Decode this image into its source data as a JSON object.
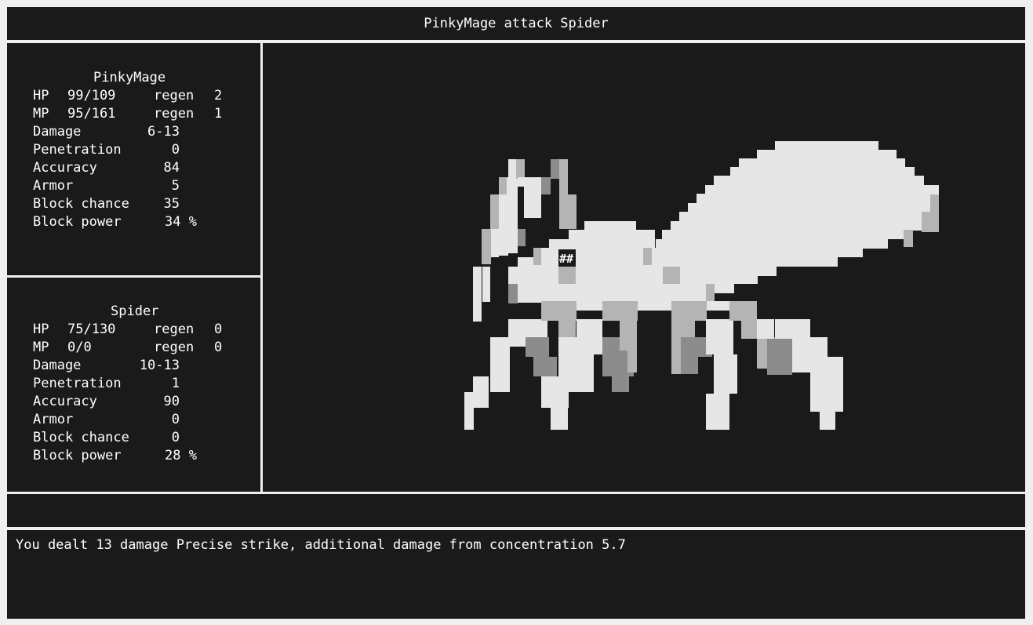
{
  "title": "PinkyMage attack Spider",
  "player": {
    "name": "PinkyMage",
    "stats": [
      {
        "label": "HP",
        "value": "99/109",
        "regen_label": "regen",
        "regen": "2"
      },
      {
        "label": "MP",
        "value": "95/161",
        "regen_label": "regen",
        "regen": "1"
      },
      {
        "label": "Damage",
        "value": "6-13"
      },
      {
        "label": "Penetration",
        "value": "0"
      },
      {
        "label": "Accuracy",
        "value": "84"
      },
      {
        "label": "Armor",
        "value": "5"
      },
      {
        "label": "Block chance",
        "value": "35"
      },
      {
        "label": "Block power",
        "value": "34 %"
      }
    ]
  },
  "enemy": {
    "name": "Spider",
    "stats": [
      {
        "label": "HP",
        "value": "75/130",
        "regen_label": "regen",
        "regen": "0"
      },
      {
        "label": "MP",
        "value": "0/0",
        "regen_label": "regen",
        "regen": "0"
      },
      {
        "label": "Damage",
        "value": "10-13"
      },
      {
        "label": "Penetration",
        "value": "1"
      },
      {
        "label": "Accuracy",
        "value": "90"
      },
      {
        "label": "Armor",
        "value": "0"
      },
      {
        "label": "Block chance",
        "value": "0"
      },
      {
        "label": "Block power",
        "value": "28 %"
      }
    ]
  },
  "monster_art": {
    "eye_text": "##",
    "colors": {
      "light": "#e6e6e6",
      "mid": "#b4b4b4",
      "dark": "#8c8c8c",
      "eye_bg": "#1a1a1a"
    }
  },
  "action_bar": {
    "text": ""
  },
  "log": {
    "lines": [
      "You dealt 13 damage Precise strike, additional damage from concentration 5.7"
    ]
  }
}
